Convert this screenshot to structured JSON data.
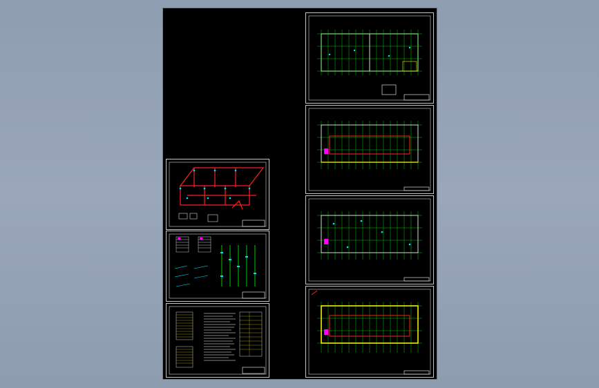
{
  "app": {
    "canvas_background": "#000000",
    "desktop_background": "#96a3b6",
    "border_color": "#c9c9c9"
  },
  "colors": {
    "grid_lines": "#00ff00",
    "pipe_red": "#ff2020",
    "cyan_symbols": "#00e5ff",
    "yellow_walls": "#ffff00",
    "magenta_symbols": "#ff00ff",
    "white_text": "#ffffff"
  },
  "sheets": {
    "floor_plan_1": {
      "kind": "floor-plan",
      "mark_color": "#ffffff"
    },
    "floor_plan_2": {
      "kind": "floor-plan",
      "mark_color": "#ff2020"
    },
    "floor_plan_3": {
      "kind": "floor-plan",
      "mark_color": "#00e5ff"
    },
    "floor_plan_4": {
      "kind": "floor-plan",
      "mark_color": "#ffff00"
    },
    "isometric_system": {
      "kind": "pipe-isometric"
    },
    "riser_diagram": {
      "kind": "riser-diagram"
    },
    "notes_tables": {
      "kind": "notes-and-tables"
    }
  }
}
